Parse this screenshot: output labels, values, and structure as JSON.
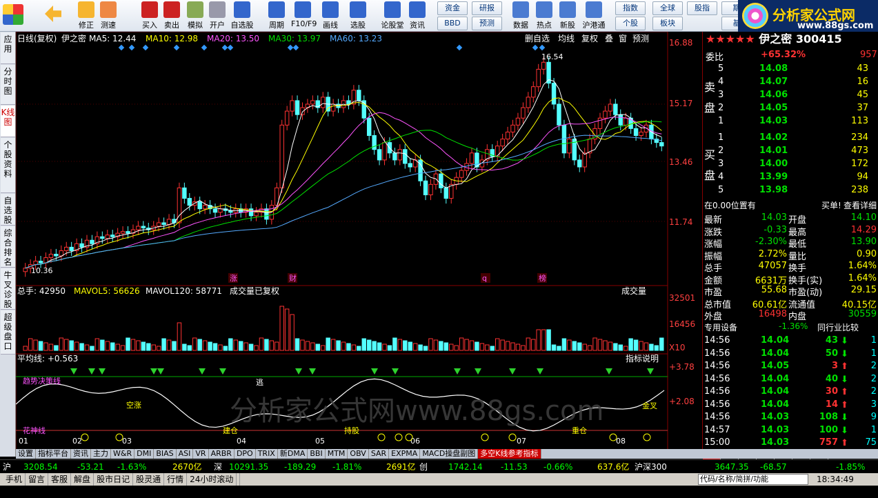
{
  "toolbar": {
    "main": [
      {
        "name": "back",
        "label": ""
      },
      {
        "name": "fix",
        "label": "修正"
      },
      {
        "name": "test",
        "label": "测速"
      },
      {
        "name": "buy",
        "label": "买入"
      },
      {
        "name": "sell",
        "label": "卖出"
      },
      {
        "name": "sim",
        "label": "模拟"
      },
      {
        "name": "open",
        "label": "开户"
      },
      {
        "name": "watch",
        "label": "自选股"
      },
      {
        "name": "period",
        "label": "周期"
      },
      {
        "name": "f10",
        "label": "F10/F9"
      },
      {
        "name": "draw",
        "label": "画线"
      },
      {
        "name": "pick",
        "label": "选股"
      },
      {
        "name": "forum",
        "label": "论股堂"
      },
      {
        "name": "news",
        "label": "资讯"
      },
      {
        "name": "data",
        "label": "数据"
      },
      {
        "name": "hot",
        "label": "热点"
      },
      {
        "name": "newshare",
        "label": "新股"
      },
      {
        "name": "hk",
        "label": "沪港通"
      }
    ],
    "small": [
      {
        "name": "fund",
        "label": "资金"
      },
      {
        "name": "research",
        "label": "研报"
      },
      {
        "name": "bbd",
        "label": "BBD"
      },
      {
        "name": "forecast",
        "label": "预测"
      },
      {
        "name": "index",
        "label": "指数"
      },
      {
        "name": "global",
        "label": "全球"
      },
      {
        "name": "rank",
        "label": "股指"
      },
      {
        "name": "futures",
        "label": "期"
      },
      {
        "name": "stock",
        "label": "个股"
      },
      {
        "name": "sector",
        "label": "板块"
      },
      {
        "name": "base",
        "label": "基"
      }
    ],
    "logo_text": "分析家公式网",
    "logo_url": "www.88gs.com"
  },
  "left_tabs": [
    "应用",
    "分时图",
    "K线图",
    "个股资料",
    "自选股",
    "综合排名",
    "牛叉诊股",
    "超级盘口"
  ],
  "kline": {
    "header": "日线(复权)",
    "stock_name": "伊之密",
    "ma": [
      {
        "label": "MA5: 12.44",
        "color": "#ffffff"
      },
      {
        "label": "MA10: 12.98",
        "color": "#ffff00"
      },
      {
        "label": "MA20: 13.50",
        "color": "#ff55ff"
      },
      {
        "label": "MA30: 13.97",
        "color": "#00e000"
      },
      {
        "label": "MA60: 13.23",
        "color": "#55aaff"
      }
    ],
    "right_menu": [
      "删自选",
      "均线",
      "复权",
      "叠",
      "窗",
      "预测"
    ],
    "price_axis": [
      "16.88",
      "15.17",
      "13.46",
      "11.74"
    ],
    "high_label": "16.54",
    "low_label": "10.36",
    "markers": [
      "涨",
      "财",
      "q",
      "榜"
    ]
  },
  "volume": {
    "header_total": "总手: 42950",
    "mavol5": "MAVOL5: 56626",
    "mavol120": "MAVOL120: 58771",
    "note": "成交量已复权",
    "selector": "成交量",
    "axis": [
      "32501",
      "16456",
      "X10"
    ]
  },
  "indicator": {
    "header": "平均线: +0.563",
    "button": "指标说明",
    "axis": [
      "+3.78",
      "+2.08"
    ],
    "labels": [
      "趋势决策线",
      "空涨",
      "逃",
      "花神线",
      "建仓",
      "持股",
      "重仓",
      "金叉"
    ],
    "dates": [
      "01",
      "02",
      "03",
      "04",
      "05",
      "06",
      "07",
      "08"
    ]
  },
  "watermark": "分析家公式网www.88gs.com",
  "right_panel": {
    "title": "伊之密 300415",
    "weibi_label": "委比",
    "weibi_pct": "+65.32%",
    "weibi_val": "957",
    "sell_label": "卖盘",
    "buy_label": "买盘",
    "asks": [
      [
        "5",
        "14.08",
        "43"
      ],
      [
        "4",
        "14.07",
        "16"
      ],
      [
        "3",
        "14.06",
        "45"
      ],
      [
        "2",
        "14.05",
        "37"
      ],
      [
        "1",
        "14.03",
        "113"
      ]
    ],
    "bids": [
      [
        "1",
        "14.02",
        "234"
      ],
      [
        "2",
        "14.01",
        "473"
      ],
      [
        "3",
        "14.00",
        "172"
      ],
      [
        "4",
        "13.99",
        "94"
      ],
      [
        "5",
        "13.98",
        "238"
      ]
    ],
    "pos_text": "在0.00位置有",
    "buy_text": "买单!",
    "detail": "查看详细",
    "quotes": [
      [
        "最新",
        "14.03",
        "开盘",
        "14.10"
      ],
      [
        "涨跌",
        "-0.33",
        "最高",
        "14.29"
      ],
      [
        "涨幅",
        "-2.30%",
        "最低",
        "13.90"
      ],
      [
        "振幅",
        "2.72%",
        "量比",
        "0.90"
      ],
      [
        "总手",
        "47057",
        "换手",
        "1.64%"
      ],
      [
        "金额",
        "6631万",
        "换手(实)",
        "1.64%"
      ],
      [
        "市盈",
        "55.68",
        "市盈(动)",
        "29.15"
      ],
      [
        "总市值",
        "60.61亿",
        "流通值",
        "40.15亿"
      ],
      [
        "外盘",
        "16498",
        "内盘",
        "30559"
      ]
    ],
    "device": "专用设备",
    "device_pct": "-1.36%",
    "compare": "同行业比较",
    "ticks": [
      [
        "14:56",
        "14.04",
        "43",
        "down",
        "1"
      ],
      [
        "14:56",
        "14.04",
        "50",
        "down",
        "1"
      ],
      [
        "14:56",
        "14.05",
        "3",
        "up",
        "2"
      ],
      [
        "14:56",
        "14.04",
        "40",
        "down",
        "2"
      ],
      [
        "14:56",
        "14.04",
        "30",
        "up",
        "2"
      ],
      [
        "14:56",
        "14.04",
        "14",
        "up",
        "3"
      ],
      [
        "14:56",
        "14.03",
        "108",
        "down",
        "9"
      ],
      [
        "14:57",
        "14.03",
        "100",
        "down",
        "1"
      ],
      [
        "15:00",
        "14.03",
        "757",
        "up",
        "75"
      ]
    ],
    "bottom_tabs": [
      "细",
      "诊",
      "分",
      "筹",
      "焰",
      "指",
      "财"
    ]
  },
  "bottom_tabs": [
    "设置",
    "指标平台",
    "资讯",
    "主力",
    "W&R",
    "DMI",
    "BIAS",
    "ASI",
    "VR",
    "ARBR",
    "DPO",
    "TRIX",
    "新DMA",
    "BBI",
    "MTM",
    "OBV",
    "SAR",
    "EXPMA",
    "MACD操盘副图",
    "多空K线参考指标"
  ],
  "status": {
    "sh_label": "沪",
    "sh_val": "3208.54",
    "sh_chg": "-53.21",
    "sh_pct": "-1.63%",
    "sh_amt": "2670亿",
    "sz_label": "深",
    "sz_val": "10291.35",
    "sz_chg": "-189.29",
    "sz_pct": "-1.81%",
    "sz_amt": "2691亿",
    "cy_label": "创",
    "cy_val": "1742.14",
    "cy_chg": "-11.53",
    "cy_pct": "-0.66%",
    "cy_amt": "637.6亿",
    "hs_label": "沪深300",
    "hs_val": "3647.35",
    "hs_chg": "-68.57",
    "hs_pct": "-1.85%"
  },
  "status2": {
    "items": [
      "手机",
      "留言",
      "客服",
      "解盘",
      "股市日记",
      "股灵通",
      "行情",
      "24小时滚动"
    ],
    "search": "代码/名称/简拼/功能",
    "time": "18:34:49"
  }
}
